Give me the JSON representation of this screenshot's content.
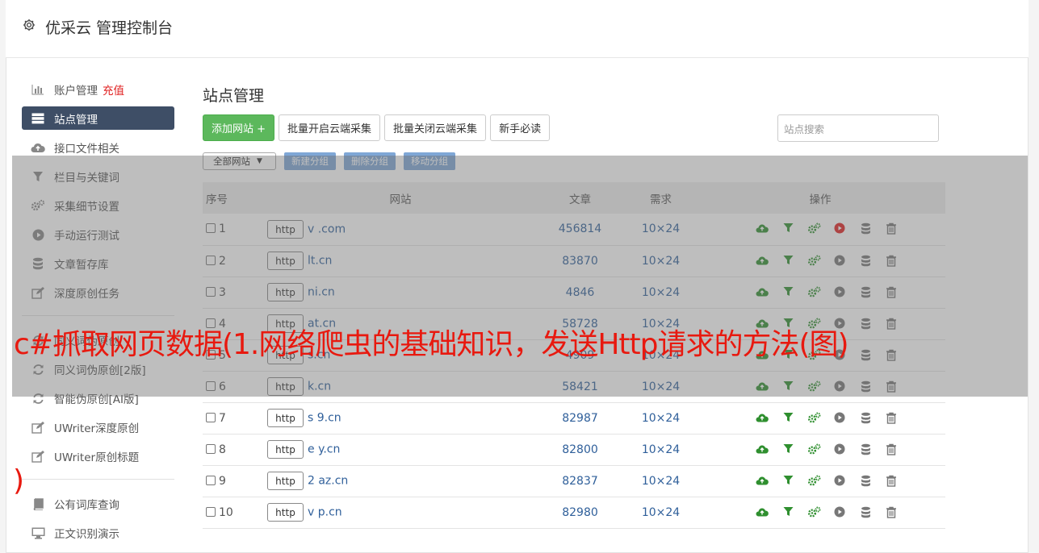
{
  "app": {
    "title": "优采云 管理控制台"
  },
  "sidebar": {
    "items": [
      {
        "label": "账户管理",
        "badge": "充值",
        "icon": "bar-chart-icon"
      },
      {
        "label": "站点管理",
        "icon": "server-list-icon",
        "active": true
      },
      {
        "label": "接口文件相关",
        "icon": "cloud-upload-icon"
      },
      {
        "label": "栏目与关键词",
        "icon": "filter-icon"
      },
      {
        "label": "采集细节设置",
        "icon": "gears-icon"
      },
      {
        "label": "手动运行测试",
        "icon": "play-circle-icon"
      },
      {
        "label": "文章暂存库",
        "icon": "database-icon"
      },
      {
        "label": "深度原创任务",
        "icon": "edit-icon"
      }
    ],
    "items2": [
      {
        "label": "同义词伪原创",
        "icon": "refresh-icon"
      },
      {
        "label": "同义词伪原创[2版]",
        "icon": "refresh-icon"
      },
      {
        "label": "智能伪原创[AI版]",
        "icon": "refresh-icon"
      },
      {
        "label": "UWriter深度原创",
        "icon": "edit-icon"
      },
      {
        "label": "UWriter原创标题",
        "icon": "edit-icon"
      }
    ],
    "items3": [
      {
        "label": "公有词库查询",
        "icon": "book-icon"
      },
      {
        "label": "正文识别演示",
        "icon": "monitor-icon"
      }
    ]
  },
  "main": {
    "title": "站点管理",
    "toolbar": {
      "add": "添加网站 +",
      "batch_open": "批量开启云端采集",
      "batch_close": "批量关闭云端采集",
      "guide": "新手必读"
    },
    "search_placeholder": "站点搜索",
    "group_select": "全部网站",
    "group_buttons": {
      "new": "新建分组",
      "delete": "删除分组",
      "move": "移动分组"
    },
    "table": {
      "headers": {
        "no": "序号",
        "site": "网站",
        "articles": "文章",
        "demand": "需求",
        "ops": "操作"
      },
      "rows": [
        {
          "no": "1",
          "proto": "http",
          "domain": "v .com",
          "articles": "456814",
          "demand": "10×24",
          "running": true
        },
        {
          "no": "2",
          "proto": "http",
          "domain": "lt.cn",
          "articles": "83870",
          "demand": "10×24",
          "running": false
        },
        {
          "no": "3",
          "proto": "http",
          "domain": "ni.cn",
          "articles": "4846",
          "demand": "10×24",
          "running": false
        },
        {
          "no": "4",
          "proto": "http",
          "domain": "at.cn",
          "articles": "58728",
          "demand": "10×24",
          "running": false
        },
        {
          "no": "5",
          "proto": "http",
          "domain": "s.cn",
          "articles": "4909",
          "demand": "10×24",
          "running": false
        },
        {
          "no": "6",
          "proto": "http",
          "domain": "k.cn",
          "articles": "58421",
          "demand": "10×24",
          "running": false
        },
        {
          "no": "7",
          "proto": "http",
          "domain": "s 9.cn",
          "articles": "82987",
          "demand": "10×24",
          "running": false
        },
        {
          "no": "8",
          "proto": "http",
          "domain": "e y.cn",
          "articles": "82800",
          "demand": "10×24",
          "running": false
        },
        {
          "no": "9",
          "proto": "http",
          "domain": "2 az.cn",
          "articles": "82837",
          "demand": "10×24",
          "running": false
        },
        {
          "no": "10",
          "proto": "http",
          "domain": "v p.cn",
          "articles": "82980",
          "demand": "10×24",
          "running": false
        }
      ]
    }
  },
  "overlay": {
    "text": "c#抓取网页数据(1.网络爬虫的基础知识，发送Http请求的方法(图)",
    "tail": ")"
  },
  "colors": {
    "green": "#5cb85c",
    "nav_active": "#3e4e66",
    "link": "#2f5f9a",
    "recharge": "#e02020",
    "overlay_text": "#e8190f"
  }
}
